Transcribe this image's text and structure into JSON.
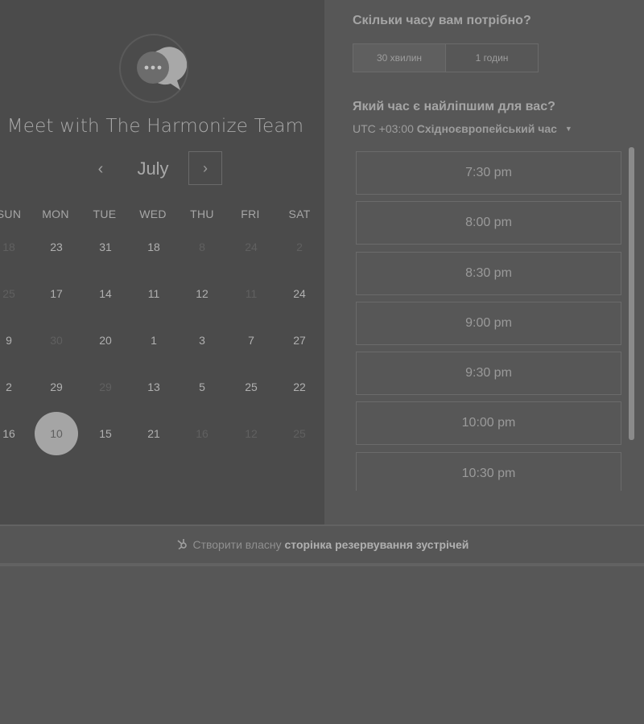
{
  "meeting": {
    "title": "Meet with The Harmonize Team",
    "avatar_icon": "chat-bubble-icon"
  },
  "calendar": {
    "month": "July",
    "prev_icon": "‹",
    "next_icon": "›",
    "weekdays": [
      "SUN",
      "MON",
      "TUE",
      "WED",
      "THU",
      "FRI",
      "SAT"
    ],
    "weeks": [
      [
        {
          "d": "18",
          "m": true
        },
        {
          "d": "23",
          "m": false
        },
        {
          "d": "31",
          "m": false
        },
        {
          "d": "18",
          "m": false
        },
        {
          "d": "8",
          "m": true
        },
        {
          "d": "24",
          "m": true
        },
        {
          "d": "2",
          "m": true
        }
      ],
      [
        {
          "d": "25",
          "m": true
        },
        {
          "d": "17",
          "m": false
        },
        {
          "d": "14",
          "m": false
        },
        {
          "d": "11",
          "m": false
        },
        {
          "d": "12",
          "m": false
        },
        {
          "d": "11",
          "m": true
        },
        {
          "d": "24",
          "m": false
        }
      ],
      [
        {
          "d": "9",
          "m": false
        },
        {
          "d": "30",
          "m": true
        },
        {
          "d": "20",
          "m": false
        },
        {
          "d": "1",
          "m": false
        },
        {
          "d": "3",
          "m": false
        },
        {
          "d": "7",
          "m": false
        },
        {
          "d": "27",
          "m": false
        }
      ],
      [
        {
          "d": "2",
          "m": false
        },
        {
          "d": "29",
          "m": false
        },
        {
          "d": "29",
          "m": true
        },
        {
          "d": "13",
          "m": false
        },
        {
          "d": "5",
          "m": false
        },
        {
          "d": "25",
          "m": false
        },
        {
          "d": "22",
          "m": false
        }
      ],
      [
        {
          "d": "16",
          "m": false
        },
        {
          "d": "10",
          "m": false,
          "selected": true
        },
        {
          "d": "15",
          "m": false
        },
        {
          "d": "21",
          "m": false
        },
        {
          "d": "16",
          "m": true
        },
        {
          "d": "12",
          "m": true
        },
        {
          "d": "25",
          "m": true
        }
      ]
    ]
  },
  "duration": {
    "question": "Скільки часу вам потрібно?",
    "options": [
      "30 хвилин",
      "1 годин"
    ],
    "selected": 0
  },
  "time": {
    "question": "Який час є найліпшим для вас?",
    "tz_offset": "UTC +03:00",
    "tz_name": "Східноєвропейський час",
    "slots": [
      "7:30 pm",
      "8:00 pm",
      "8:30 pm",
      "9:00 pm",
      "9:30 pm",
      "10:00 pm",
      "10:30 pm"
    ]
  },
  "footer": {
    "icon": "hubspot-sprocket-icon",
    "prefix": "Створити власну",
    "link": "сторінка резервування зустрічей"
  },
  "colors": {
    "overlay_dark": "#4b4b4b",
    "overlay_light": "#575757"
  }
}
